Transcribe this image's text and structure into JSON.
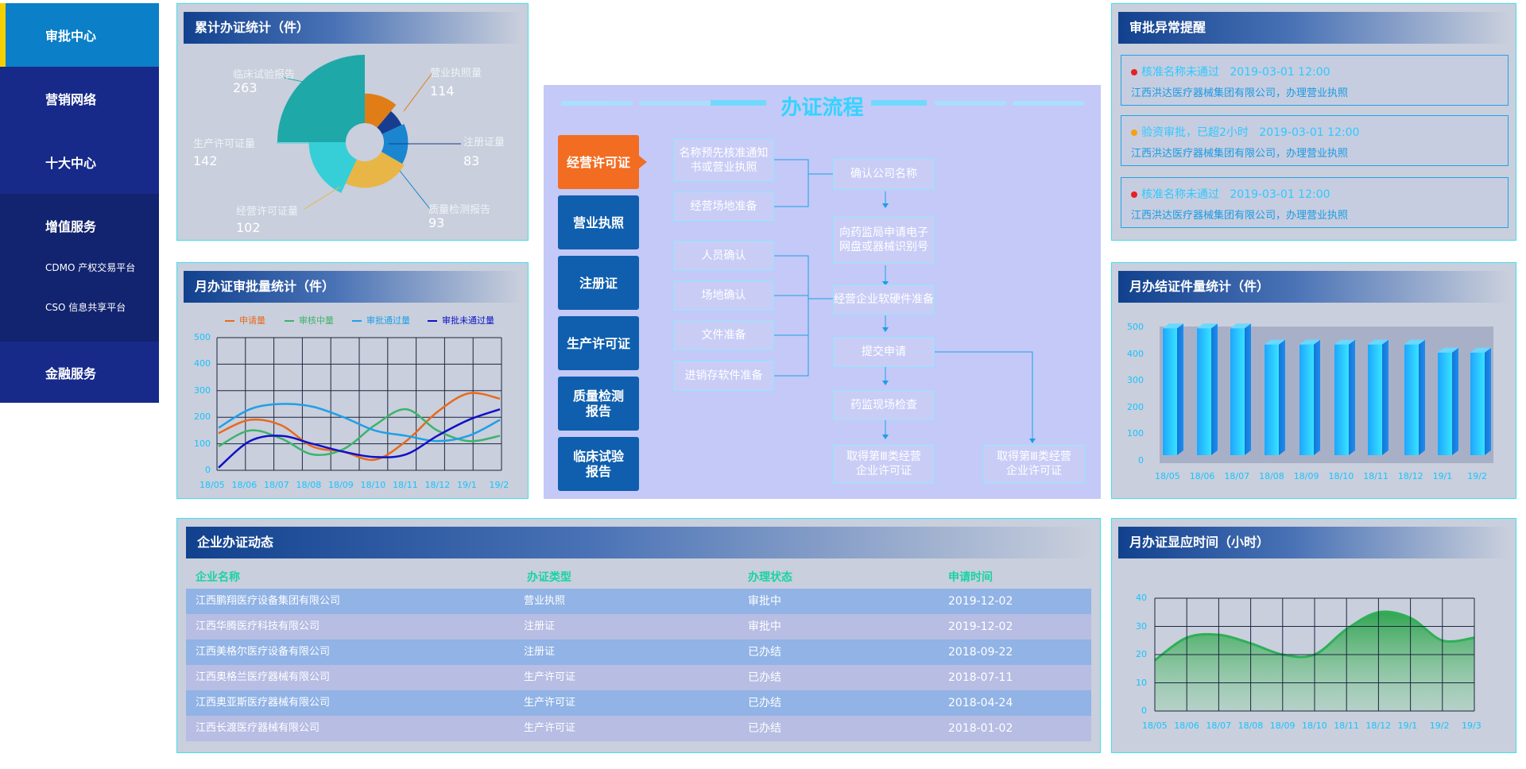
{
  "sidebar": {
    "items": [
      {
        "label": "审批中心"
      },
      {
        "label": "营销网络"
      },
      {
        "label": "十大中心"
      },
      {
        "label": "增值服务"
      },
      {
        "label": "CDMO 产权交易平台"
      },
      {
        "label": "CSO 信息共享平台"
      },
      {
        "label": "金融服务"
      }
    ]
  },
  "cumulative": {
    "title": "累计办证统计（件）",
    "chart_data": {
      "type": "pie",
      "labels": [
        "临床试验报告",
        "营业执照量",
        "注册证量",
        "质量检测报告",
        "经营许可证量",
        "生产许可证量"
      ],
      "values": [
        263,
        114,
        83,
        93,
        102,
        142
      ],
      "colors": [
        "#1fa8a8",
        "#e07d17",
        "#183d8e",
        "#1a86cf",
        "#e8b647",
        "#36cfd8"
      ]
    },
    "labels": {
      "clinical": {
        "name": "临床试验报告",
        "value": "263"
      },
      "license": {
        "name": "营业执照量",
        "value": "114"
      },
      "registration": {
        "name": "注册证量",
        "value": "83"
      },
      "quality": {
        "name": "质量检测报告",
        "value": "93"
      },
      "operating": {
        "name": "经营许可证量",
        "value": "102"
      },
      "production": {
        "name": "生产许可证量",
        "value": "142"
      }
    }
  },
  "monthly_approval": {
    "title": "月办证审批量统计（件）",
    "chart_data": {
      "type": "line",
      "categories": [
        "18/05",
        "18/06",
        "18/07",
        "18/08",
        "18/09",
        "18/10",
        "18/11",
        "18/12",
        "19/1",
        "19/2"
      ],
      "ylim": [
        0,
        500
      ],
      "yticks": [
        "500",
        "400",
        "300",
        "200",
        "100",
        "0"
      ],
      "series": [
        {
          "name": "申请量",
          "color": "#e86a1c",
          "values": [
            140,
            190,
            170,
            90,
            70,
            40,
            110,
            220,
            290,
            270
          ]
        },
        {
          "name": "审核中量",
          "color": "#3db36b",
          "values": [
            90,
            150,
            120,
            60,
            80,
            170,
            230,
            150,
            110,
            130
          ]
        },
        {
          "name": "审批通过量",
          "color": "#1f9fe8",
          "values": [
            160,
            230,
            250,
            240,
            200,
            150,
            130,
            110,
            130,
            190
          ]
        },
        {
          "name": "审批未通过量",
          "color": "#1010c8",
          "values": [
            10,
            110,
            130,
            100,
            70,
            50,
            60,
            130,
            190,
            230
          ]
        }
      ]
    }
  },
  "process": {
    "title": "办证流程",
    "buttons": [
      "经营许可证",
      "营业执照",
      "注册证",
      "生产许可证",
      "质量检测报告",
      "临床试验报告"
    ],
    "boxes": {
      "b1": "名称预先核准通知书或营业执照",
      "b2": "经营场地准备",
      "b3": "人员确认",
      "b4": "场地确认",
      "b5": "文件准备",
      "b6": "进销存软件准备",
      "c1": "确认公司名称",
      "c2": "向药监局申请电子网盘或器械识别号",
      "c3": "经营企业软硬件准备",
      "c4": "提交申请",
      "c5": "药监现场检查",
      "c6": "取得第Ⅲ类经营企业许可证",
      "d1": "取得第Ⅲ类经营企业许可证"
    }
  },
  "alerts": {
    "title": "审批异常提醒",
    "items": [
      {
        "status": "核准名称未通过",
        "time": "2019-03-01 12:00",
        "desc": "江西洪达医疗器械集团有限公司，办理营业执照",
        "dot_color": "#e52222"
      },
      {
        "status": "验资审批，已超2小时",
        "time": "2019-03-01 12:00",
        "desc": "江西洪达医疗器械集团有限公司，办理营业执照",
        "dot_color": "#f4a20c"
      },
      {
        "status": "核准名称未通过",
        "time": "2019-03-01 12:00",
        "desc": "江西洪达医疗器械集团有限公司，办理营业执照",
        "dot_color": "#e52222"
      }
    ]
  },
  "monthly_completed": {
    "title": "月办结证件量统计（件）",
    "chart_data": {
      "type": "bar",
      "categories": [
        "18/05",
        "18/06",
        "18/07",
        "18/08",
        "18/09",
        "18/10",
        "18/11",
        "18/12",
        "19/1",
        "19/2"
      ],
      "values": [
        470,
        470,
        470,
        410,
        410,
        410,
        410,
        410,
        380,
        380
      ],
      "ylim": [
        0,
        500
      ],
      "yticks": [
        "500",
        "400",
        "300",
        "200",
        "100",
        "0"
      ]
    }
  },
  "dynamics": {
    "title": "企业办证动态",
    "headers": [
      "企业名称",
      "办证类型",
      "办理状态",
      "申请时间"
    ],
    "rows": [
      [
        "江西鹏翔医疗设备集团有限公司",
        "营业执照",
        "审批中",
        "2019-12-02"
      ],
      [
        "江西华腾医疗科技有限公司",
        "注册证",
        "审批中",
        "2019-12-02"
      ],
      [
        "江西美格尔医疗设备有限公司",
        "注册证",
        "已办结",
        "2018-09-22"
      ],
      [
        "江西奥格兰医疗器械有限公司",
        "生产许可证",
        "已办结",
        "2018-07-11"
      ],
      [
        "江西奥亚斯医疗器械有限公司",
        "生产许可证",
        "已办结",
        "2018-04-24"
      ],
      [
        "江西长渡医疗器械有限公司",
        "生产许可证",
        "已办结",
        "2018-01-02"
      ]
    ]
  },
  "response_time": {
    "title": "月办证显应时间（小时）",
    "chart_data": {
      "type": "area",
      "categories": [
        "18/05",
        "18/06",
        "18/07",
        "18/08",
        "18/09",
        "18/10",
        "18/11",
        "18/12",
        "19/1",
        "19/2",
        "19/3"
      ],
      "values": [
        18,
        26,
        27,
        24,
        20,
        20,
        29,
        35,
        33,
        25,
        26
      ],
      "ylim": [
        0,
        40
      ],
      "yticks": [
        "40",
        "30",
        "20",
        "10",
        "0"
      ]
    }
  }
}
